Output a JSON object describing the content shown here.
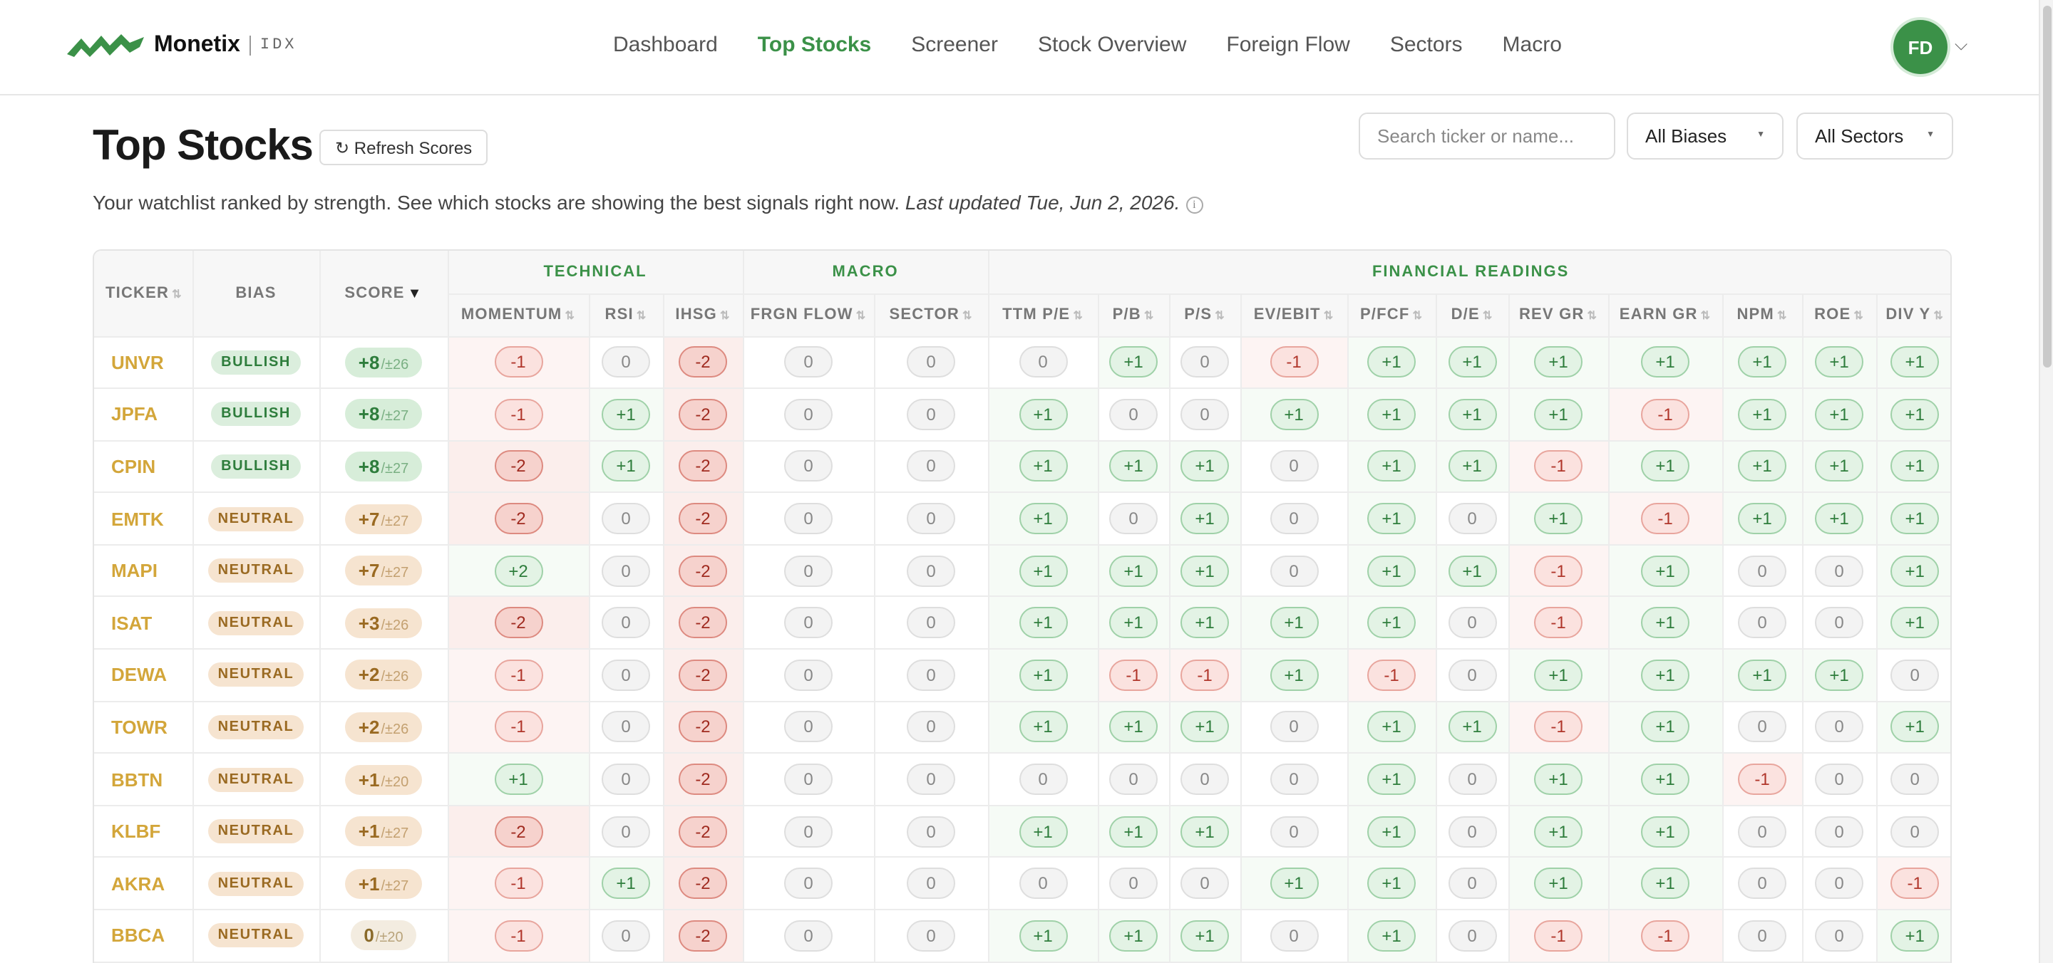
{
  "brand": {
    "name": "Monetix",
    "suffix": "IDX"
  },
  "nav": [
    "Dashboard",
    "Top Stocks",
    "Screener",
    "Stock Overview",
    "Foreign Flow",
    "Sectors",
    "Macro"
  ],
  "nav_active": "Top Stocks",
  "user": {
    "initials": "FD"
  },
  "page": {
    "title": "Top Stocks",
    "refresh_label": "↻ Refresh Scores",
    "subtitle": "Your watchlist ranked by strength. See which stocks are showing the best signals right now.",
    "updated": "Last updated Tue, Jun 2, 2026.",
    "search_placeholder": "Search ticker or name...",
    "bias_filter": "All Biases",
    "sector_filter": "All Sectors"
  },
  "colors": {
    "accent": "#3b9148",
    "ticker": "#d3a63a",
    "positive": "#2e7d3c",
    "negative": "#b0362b"
  },
  "table": {
    "headers": {
      "ticker": "TICKER",
      "bias": "BIAS",
      "score": "SCORE"
    },
    "groups": [
      {
        "label": "TECHNICAL",
        "span": 3
      },
      {
        "label": "MACRO",
        "span": 2
      },
      {
        "label": "FINANCIAL READINGS",
        "span": 11
      }
    ],
    "factors": [
      "MOMENTUM",
      "RSI",
      "IHSG",
      "FRGN FLOW",
      "SECTOR",
      "TTM P/E",
      "P/B",
      "P/S",
      "EV/EBIT",
      "P/FCF",
      "D/E",
      "REV GR",
      "EARN GR",
      "NPM",
      "ROE",
      "DIV Y"
    ],
    "rows": [
      {
        "ticker": "UNVR",
        "bias": "BULLISH",
        "score": "+8",
        "range": "/±26",
        "v": [
          -1,
          0,
          -2,
          0,
          0,
          0,
          1,
          0,
          -1,
          1,
          1,
          1,
          1,
          1,
          1,
          1
        ]
      },
      {
        "ticker": "JPFA",
        "bias": "BULLISH",
        "score": "+8",
        "range": "/±27",
        "v": [
          -1,
          1,
          -2,
          0,
          0,
          1,
          0,
          0,
          1,
          1,
          1,
          1,
          -1,
          1,
          1,
          1
        ]
      },
      {
        "ticker": "CPIN",
        "bias": "BULLISH",
        "score": "+8",
        "range": "/±27",
        "v": [
          -2,
          1,
          -2,
          0,
          0,
          1,
          1,
          1,
          0,
          1,
          1,
          -1,
          1,
          1,
          1,
          1
        ]
      },
      {
        "ticker": "EMTK",
        "bias": "NEUTRAL",
        "score": "+7",
        "range": "/±27",
        "v": [
          -2,
          0,
          -2,
          0,
          0,
          1,
          0,
          1,
          0,
          1,
          0,
          1,
          -1,
          1,
          1,
          1
        ]
      },
      {
        "ticker": "MAPI",
        "bias": "NEUTRAL",
        "score": "+7",
        "range": "/±27",
        "v": [
          2,
          0,
          -2,
          0,
          0,
          1,
          1,
          1,
          0,
          1,
          1,
          -1,
          1,
          0,
          0,
          1
        ]
      },
      {
        "ticker": "ISAT",
        "bias": "NEUTRAL",
        "score": "+3",
        "range": "/±26",
        "v": [
          -2,
          0,
          -2,
          0,
          0,
          1,
          1,
          1,
          1,
          1,
          0,
          -1,
          1,
          0,
          0,
          1
        ]
      },
      {
        "ticker": "DEWA",
        "bias": "NEUTRAL",
        "score": "+2",
        "range": "/±26",
        "v": [
          -1,
          0,
          -2,
          0,
          0,
          1,
          -1,
          -1,
          1,
          -1,
          0,
          1,
          1,
          1,
          1,
          0
        ]
      },
      {
        "ticker": "TOWR",
        "bias": "NEUTRAL",
        "score": "+2",
        "range": "/±26",
        "v": [
          -1,
          0,
          -2,
          0,
          0,
          1,
          1,
          1,
          0,
          1,
          1,
          -1,
          1,
          0,
          0,
          1
        ]
      },
      {
        "ticker": "BBTN",
        "bias": "NEUTRAL",
        "score": "+1",
        "range": "/±20",
        "v": [
          1,
          0,
          -2,
          0,
          0,
          0,
          0,
          0,
          0,
          1,
          0,
          1,
          1,
          -1,
          0,
          0
        ]
      },
      {
        "ticker": "KLBF",
        "bias": "NEUTRAL",
        "score": "+1",
        "range": "/±27",
        "v": [
          -2,
          0,
          -2,
          0,
          0,
          1,
          1,
          1,
          0,
          1,
          0,
          1,
          1,
          0,
          0,
          0
        ]
      },
      {
        "ticker": "AKRA",
        "bias": "NEUTRAL",
        "score": "+1",
        "range": "/±27",
        "v": [
          -1,
          1,
          -2,
          0,
          0,
          0,
          0,
          0,
          1,
          1,
          0,
          1,
          1,
          0,
          0,
          -1
        ]
      },
      {
        "ticker": "BBCA",
        "bias": "NEUTRAL",
        "score": "0",
        "range": "/±20",
        "v": [
          -1,
          0,
          -2,
          0,
          0,
          1,
          1,
          1,
          0,
          1,
          0,
          -1,
          -1,
          0,
          0,
          1
        ]
      }
    ]
  }
}
